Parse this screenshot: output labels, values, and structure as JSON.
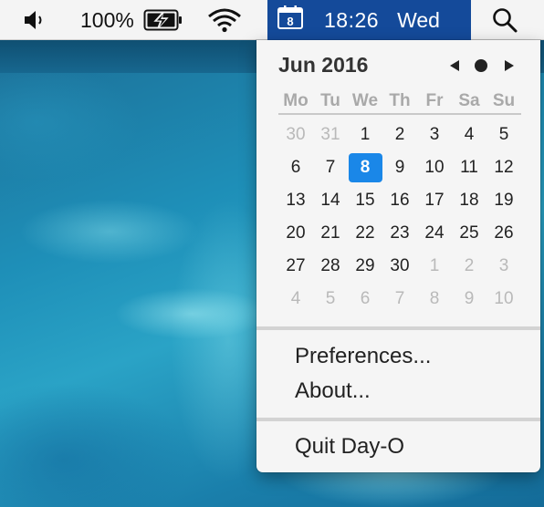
{
  "menubar": {
    "battery_percent": "100%",
    "time": "18:26",
    "day": "Wed",
    "calendar_icon_day": "8",
    "icons": [
      "volume-icon",
      "battery-charging-icon",
      "wifi-icon",
      "calendar-icon",
      "search-icon"
    ]
  },
  "calendar": {
    "month_title": "Jun 2016",
    "weekdays": [
      "Mo",
      "Tu",
      "We",
      "Th",
      "Fr",
      "Sa",
      "Su"
    ],
    "today": "8",
    "weeks": [
      [
        {
          "d": "30",
          "m": "prev"
        },
        {
          "d": "31",
          "m": "prev"
        },
        {
          "d": "1"
        },
        {
          "d": "2"
        },
        {
          "d": "3"
        },
        {
          "d": "4"
        },
        {
          "d": "5"
        }
      ],
      [
        {
          "d": "6"
        },
        {
          "d": "7"
        },
        {
          "d": "8",
          "today": true
        },
        {
          "d": "9"
        },
        {
          "d": "10"
        },
        {
          "d": "11"
        },
        {
          "d": "12"
        }
      ],
      [
        {
          "d": "13"
        },
        {
          "d": "14"
        },
        {
          "d": "15"
        },
        {
          "d": "16"
        },
        {
          "d": "17"
        },
        {
          "d": "18"
        },
        {
          "d": "19"
        }
      ],
      [
        {
          "d": "20"
        },
        {
          "d": "21"
        },
        {
          "d": "22"
        },
        {
          "d": "23"
        },
        {
          "d": "24"
        },
        {
          "d": "25"
        },
        {
          "d": "26"
        }
      ],
      [
        {
          "d": "27"
        },
        {
          "d": "28"
        },
        {
          "d": "29"
        },
        {
          "d": "30"
        },
        {
          "d": "1",
          "m": "next"
        },
        {
          "d": "2",
          "m": "next"
        },
        {
          "d": "3",
          "m": "next"
        }
      ],
      [
        {
          "d": "4",
          "m": "next"
        },
        {
          "d": "5",
          "m": "next"
        },
        {
          "d": "6",
          "m": "next"
        },
        {
          "d": "7",
          "m": "next"
        },
        {
          "d": "8",
          "m": "next"
        },
        {
          "d": "9",
          "m": "next"
        },
        {
          "d": "10",
          "m": "next"
        }
      ]
    ]
  },
  "menu": {
    "preferences": "Preferences...",
    "about": "About...",
    "quit": "Quit Day-O"
  },
  "colors": {
    "menubar_highlight": "#144a9a",
    "today_highlight": "#1a87e8"
  }
}
